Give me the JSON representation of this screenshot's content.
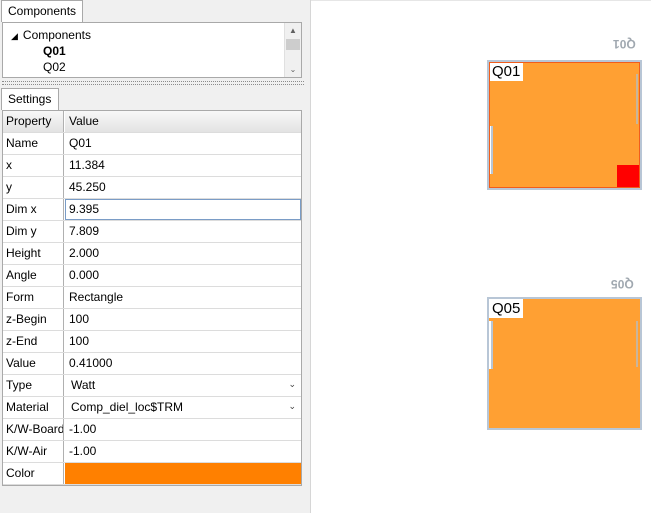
{
  "tabs": {
    "components": "Components",
    "settings": "Settings"
  },
  "tree": {
    "root": "Components",
    "items": [
      "Q01",
      "Q02"
    ],
    "selected": "Q01"
  },
  "grid": {
    "header": {
      "property": "Property",
      "value": "Value"
    },
    "rows": [
      {
        "property": "Name",
        "value": "Q01"
      },
      {
        "property": "x",
        "value": "11.384"
      },
      {
        "property": "y",
        "value": "45.250"
      },
      {
        "property": "Dim x",
        "value": "9.395"
      },
      {
        "property": "Dim y",
        "value": "7.809"
      },
      {
        "property": "Height",
        "value": "2.000"
      },
      {
        "property": "Angle",
        "value": "0.000"
      },
      {
        "property": "Form",
        "value": "Rectangle"
      },
      {
        "property": "z-Begin",
        "value": "100"
      },
      {
        "property": "z-End",
        "value": "100"
      },
      {
        "property": "Value",
        "value": "0.41000"
      },
      {
        "property": "Type",
        "value": "Watt"
      },
      {
        "property": "Material",
        "value": "Comp_diel_loc$TRM"
      },
      {
        "property": "K/W-Board",
        "value": "-1.00"
      },
      {
        "property": "K/W-Air",
        "value": "-1.00"
      },
      {
        "property": "Color",
        "value": ""
      }
    ]
  },
  "canvas": {
    "components": [
      {
        "label": "Q01",
        "flipped_label": "Q01"
      },
      {
        "label": "Q05",
        "flipped_label": "Q05"
      }
    ]
  },
  "colors": {
    "component_fill": "#ffa033",
    "selected_color": "#ff8000",
    "marker": "#ff0000"
  },
  "icons": {
    "tree_expand": "triangle-down-icon",
    "dropdown": "chevron-down-icon",
    "scroll_up": "arrow-up-icon",
    "scroll_down": "arrow-down-icon"
  }
}
